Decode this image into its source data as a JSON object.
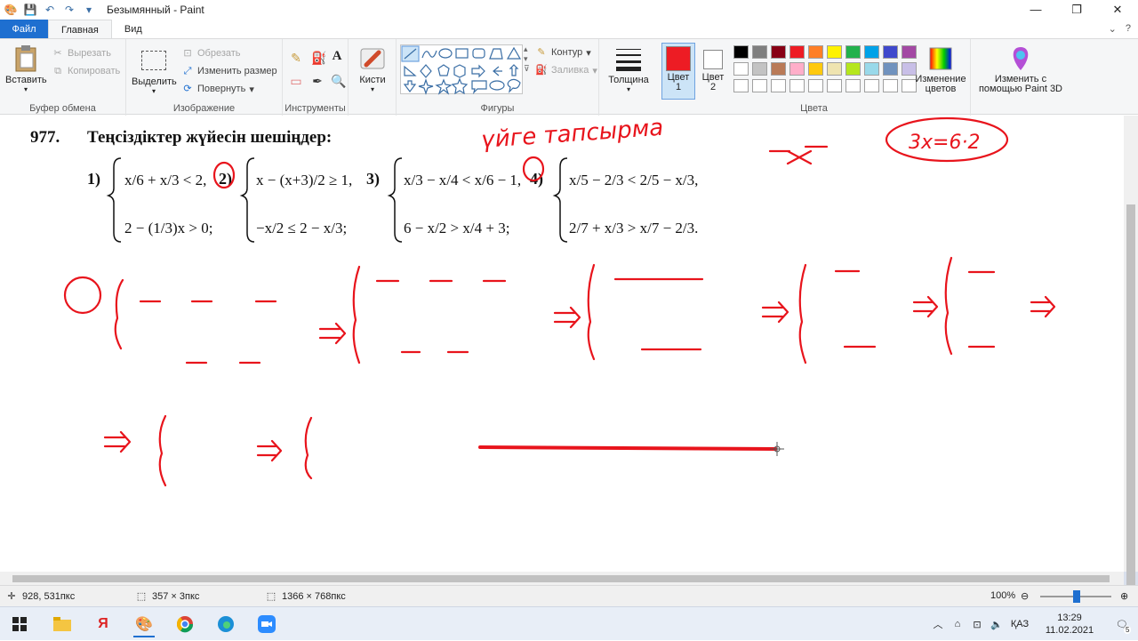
{
  "window": {
    "title": "Безымянный - Paint",
    "minimize": "—",
    "maximize": "❐",
    "close": "✕"
  },
  "tabs": {
    "file": "Файл",
    "home": "Главная",
    "view": "Вид",
    "collapse": "⌄",
    "help": "?"
  },
  "ribbon": {
    "clipboard": {
      "label": "Буфер обмена",
      "paste": "Вставить",
      "cut": "Вырезать",
      "copy": "Копировать"
    },
    "image": {
      "label": "Изображение",
      "select": "Выделить",
      "crop": "Обрезать",
      "resize": "Изменить размер",
      "rotate": "Повернуть"
    },
    "tools": {
      "label": "Инструменты",
      "text_tool": "A"
    },
    "brushes": {
      "label": "Кисти"
    },
    "shapes": {
      "label": "Фигуры",
      "outline": "Контур",
      "fill": "Заливка"
    },
    "size": {
      "label": "Толщина"
    },
    "colors": {
      "label": "Цвета",
      "color1": "Цвет\n1",
      "color2": "Цвет\n2",
      "edit_colors": "Изменение цветов",
      "paint3d": "Изменить с помощью Paint 3D",
      "color1_value": "#ed1c24",
      "color2_value": "#ffffff",
      "palette": [
        "#000000",
        "#7f7f7f",
        "#880015",
        "#ed1c24",
        "#ff7f27",
        "#fff200",
        "#22b14c",
        "#00a2e8",
        "#3f48cc",
        "#a349a4",
        "#ffffff",
        "#c3c3c3",
        "#b97a57",
        "#ffaec9",
        "#ffc90e",
        "#efe4b0",
        "#b5e61d",
        "#99d9ea",
        "#7092be",
        "#c8bfe7",
        "#ffffff",
        "#ffffff",
        "#ffffff",
        "#ffffff",
        "#ffffff",
        "#ffffff",
        "#ffffff",
        "#ffffff",
        "#ffffff",
        "#ffffff"
      ]
    }
  },
  "canvas": {
    "problem_number": "977.",
    "problem_title": "Теңсіздіктер жүйесін шешіңдер:",
    "handwritten_note": "үйге тапсырма",
    "handwritten_eq": "3x=6·2",
    "item_labels": [
      "1)",
      "2)",
      "3)",
      "4)"
    ],
    "sys1": [
      "x/6 + x/3 < 2,",
      "2 − (1/3)x > 0;"
    ],
    "sys2": [
      "x − (x+3)/2 ≥ 1,",
      "−x/2 ≤ 2 − x/3;"
    ],
    "sys3": [
      "x/3 − x/4 < x/6 − 1,",
      "6 − x/2 > x/4 + 3;"
    ],
    "sys4": [
      "x/5 − 2/3 < 2/5 − x/3,",
      "2/7 + x/3 > x/7 − 2/3."
    ]
  },
  "status": {
    "cursor_pos": "928, 531пкс",
    "selection_size": "357 × 3пкс",
    "image_size": "1366 × 768пкс",
    "zoom": "100%"
  },
  "taskbar": {
    "lang": "ҚАЗ",
    "time": "13:29",
    "date": "11.02.2021",
    "notifications": "5"
  }
}
